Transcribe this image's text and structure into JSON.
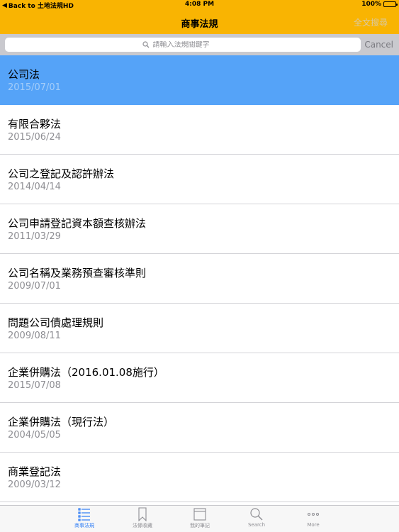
{
  "status_bar": {
    "back_label": "Back to 土地法規HD",
    "time": "4:08 PM",
    "battery_percent": "100%",
    "battery_level": 1.0
  },
  "nav": {
    "title": "商事法規",
    "right_button": "全文搜尋"
  },
  "search": {
    "placeholder": "請輸入法規關鍵字",
    "value": "",
    "cancel_label": "Cancel",
    "icon": "search-icon"
  },
  "laws": [
    {
      "title": "公司法",
      "date": "2015/07/01",
      "selected": true
    },
    {
      "title": "有限合夥法",
      "date": "2015/06/24",
      "selected": false
    },
    {
      "title": "公司之登記及認許辦法",
      "date": "2014/04/14",
      "selected": false
    },
    {
      "title": "公司申請登記資本額查核辦法",
      "date": "2011/03/29",
      "selected": false
    },
    {
      "title": "公司名稱及業務預查審核準則",
      "date": "2009/07/01",
      "selected": false
    },
    {
      "title": "問題公司債處理規則",
      "date": "2009/08/11",
      "selected": false
    },
    {
      "title": "企業併購法（2016.01.08施行）",
      "date": "2015/07/08",
      "selected": false
    },
    {
      "title": "企業併購法（現行法）",
      "date": "2004/05/05",
      "selected": false
    },
    {
      "title": "商業登記法",
      "date": "2009/03/12",
      "selected": false
    }
  ],
  "tabs": [
    {
      "label": "商事法規",
      "icon": "list-icon",
      "active": true
    },
    {
      "label": "法條收藏",
      "icon": "bookmark-icon",
      "active": false
    },
    {
      "label": "我的筆記",
      "icon": "notebook-icon",
      "active": false
    },
    {
      "label": "Search",
      "icon": "search-icon",
      "active": false
    },
    {
      "label": "More",
      "icon": "more-icon",
      "active": false
    }
  ],
  "colors": {
    "accent": "#f9b402",
    "selected_row": "#55a3f8",
    "tab_active": "#2e7cf6",
    "tab_inactive": "#8e8e93"
  }
}
